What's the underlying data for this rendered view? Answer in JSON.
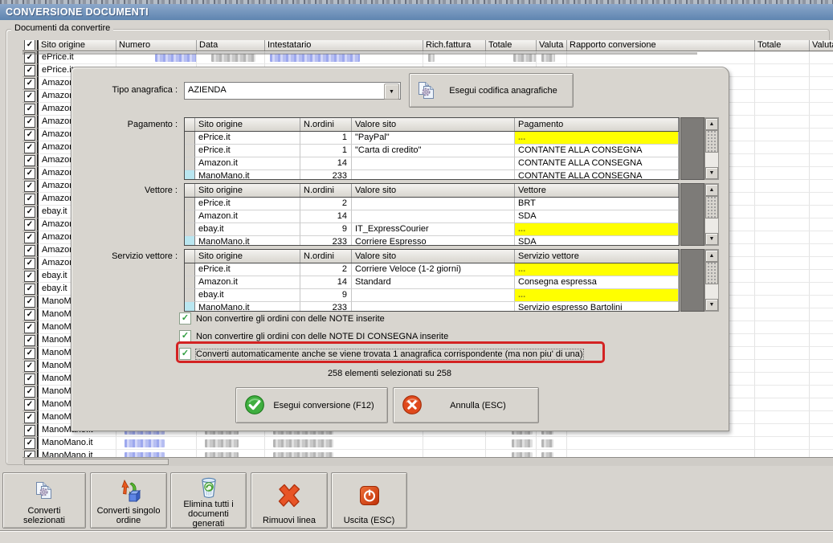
{
  "window": {
    "title": "CONVERSIONE DOCUMENTI"
  },
  "groupbox": {
    "label": "Documenti da convertire"
  },
  "main_table": {
    "headers": [
      "Sito origine",
      "Numero",
      "Data",
      "Intestatario",
      "Rich.fattura",
      "Totale",
      "Valuta",
      "Rapporto conversione",
      "Totale",
      "Valuta"
    ],
    "rows": [
      "ePrice.it",
      "ePrice.it",
      "Amazon.it",
      "Amazon.it",
      "Amazon.it",
      "Amazon.it",
      "Amazon.it",
      "Amazon.it",
      "Amazon.it",
      "Amazon.it",
      "Amazon.it",
      "Amazon.it",
      "ebay.it",
      "Amazon.it",
      "Amazon.it",
      "Amazon.it",
      "Amazon.it",
      "ebay.it",
      "ebay.it",
      "ManoMano.it",
      "ManoMano.it",
      "ManoMano.it",
      "ManoMano.it",
      "ManoMano.it",
      "ManoMano.it",
      "ManoMano.it",
      "ManoMano.it",
      "ManoMano.it",
      "ManoMano.it",
      "ManoMano.it",
      "ManoMano.it",
      "ManoMano.it"
    ]
  },
  "dialog": {
    "tipo_label": "Tipo anagrafica :",
    "tipo_value": "AZIENDA",
    "codifica_button": {
      "label": "Esegui codifica anagrafiche",
      "icon": "pages-gear-icon"
    },
    "sections": [
      {
        "label": "Pagamento :",
        "headers": [
          "Sito origine",
          "N.ordini",
          "Valore sito",
          "Pagamento"
        ],
        "rows": [
          {
            "cells": [
              "ePrice.it",
              "1",
              "\"PayPal\"",
              "..."
            ],
            "value_highlight": true
          },
          {
            "cells": [
              "ePrice.it",
              "1",
              "\"Carta di credito\"",
              "CONTANTE ALLA CONSEGNA"
            ]
          },
          {
            "cells": [
              "Amazon.it",
              "14",
              "",
              "CONTANTE ALLA CONSEGNA"
            ]
          },
          {
            "cells": [
              "ManoMano.it",
              "233",
              "",
              "CONTANTE ALLA CONSEGNA"
            ],
            "selected": true
          }
        ]
      },
      {
        "label": "Vettore :",
        "headers": [
          "Sito origine",
          "N.ordini",
          "Valore sito",
          "Vettore"
        ],
        "rows": [
          {
            "cells": [
              "ePrice.it",
              "2",
              "",
              "BRT"
            ]
          },
          {
            "cells": [
              "Amazon.it",
              "14",
              "",
              "SDA"
            ]
          },
          {
            "cells": [
              "ebay.it",
              "9",
              "IT_ExpressCourier",
              "..."
            ],
            "value_highlight": true
          },
          {
            "cells": [
              "ManoMano.it",
              "233",
              "Corriere Espresso",
              "SDA"
            ],
            "selected": true
          }
        ]
      },
      {
        "label": "Servizio vettore :",
        "headers": [
          "Sito origine",
          "N.ordini",
          "Valore sito",
          "Servizio vettore"
        ],
        "rows": [
          {
            "cells": [
              "ePrice.it",
              "2",
              "Corriere Veloce (1-2 giorni)",
              "..."
            ],
            "value_highlight": true
          },
          {
            "cells": [
              "Amazon.it",
              "14",
              "Standard",
              "Consegna espressa"
            ]
          },
          {
            "cells": [
              "ebay.it",
              "9",
              "",
              "..."
            ],
            "value_highlight": true
          },
          {
            "cells": [
              "ManoMano.it",
              "233",
              "",
              "Servizio espresso Bartolini"
            ],
            "selected": true
          }
        ]
      }
    ],
    "checkboxes": [
      {
        "label": "Non convertire gli ordini con delle NOTE inserite",
        "checked": true
      },
      {
        "label": "Non convertire gli ordini con delle NOTE DI CONSEGNA inserite",
        "checked": true
      },
      {
        "label": "Converti automaticamente anche se viene trovata 1 anagrafica corrispondente (ma non piu' di una)",
        "checked": true,
        "highlighted": true
      }
    ],
    "count_text": "258 elementi selezionati su 258",
    "convert_button": {
      "label": "Esegui conversione (F12)",
      "icon": "green-check-circle-icon"
    },
    "cancel_button": {
      "label": "Annulla (ESC)",
      "icon": "red-x-circle-icon"
    }
  },
  "toolbar": {
    "buttons": [
      {
        "label": "Converti\nselezionati",
        "icon": "pages-gear-icon"
      },
      {
        "label": "Converti singolo\nordine",
        "icon": "convert-arrows-cube-icon"
      },
      {
        "label": "Elimina tutti i\ndocumenti\ngenerati",
        "icon": "trash-recycle-icon"
      },
      {
        "label": "Rimuovi linea",
        "icon": "red-x-icon"
      },
      {
        "label": "Uscita (ESC)",
        "icon": "power-icon"
      }
    ]
  },
  "colors": {
    "title_bar": "#6d92bb",
    "highlight_yellow": "#ffff00",
    "alert_red": "#d32323",
    "selected_cyan": "#b9e6f0"
  }
}
